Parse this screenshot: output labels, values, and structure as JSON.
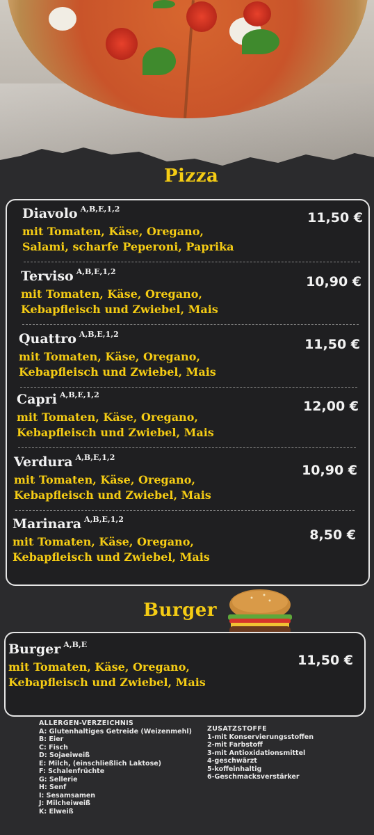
{
  "pizza": {
    "title": "Pizza",
    "items": [
      {
        "name": "Diavolo",
        "allergens": "A,B,E,1,2",
        "desc1": "mit Tomaten, Käse, Oregano,",
        "desc2": "Salami, scharfe Peperoni, Paprika",
        "price": "11,50 €"
      },
      {
        "name": "Terviso",
        "allergens": "A,B,E,1,2",
        "desc1": "mit Tomaten, Käse, Oregano,",
        "desc2": "Kebapfleisch und Zwiebel, Mais",
        "price": "10,90 €"
      },
      {
        "name": "Quattro",
        "allergens": "A,B,E,1,2",
        "desc1": "mit Tomaten, Käse, Oregano,",
        "desc2": "Kebapfleisch und Zwiebel, Mais",
        "price": "11,50 €"
      },
      {
        "name": "Capri",
        "allergens": "A,B,E,1,2",
        "desc1": "mit Tomaten, Käse, Oregano,",
        "desc2": "Kebapfleisch und Zwiebel, Mais",
        "price": "12,00 €"
      },
      {
        "name": "Verdura",
        "allergens": "A,B,E,1,2",
        "desc1": "mit Tomaten, Käse, Oregano,",
        "desc2": "Kebapfleisch und Zwiebel, Mais",
        "price": "10,90 €"
      },
      {
        "name": "Marinara",
        "allergens": "A,B,E,1,2",
        "desc1": "mit Tomaten, Käse, Oregano,",
        "desc2": "Kebapfleisch und Zwiebel, Mais",
        "price": "8,50 €"
      }
    ]
  },
  "burger": {
    "title": "Burger",
    "items": [
      {
        "name": "Burger",
        "allergens": "A,B,E",
        "desc1": "mit Tomaten, Käse, Oregano,",
        "desc2": "Kebapfleisch und Zwiebel, Mais",
        "price": "11,50 €"
      }
    ]
  },
  "allergen_list": {
    "heading": "ALLERGEN-VERZEICHNIS",
    "lines": [
      "A:  Glutenhaltiges Getreide (Weizenmehl)",
      "B:  Eier",
      "C:  Fisch",
      "D:  Sojaeiweiß",
      "E:  Milch,  (einschließlich Laktose)",
      "F:  Schalenfrüchte",
      "G:  Sellerie",
      "H:  Senf",
      "I:   Sesamsamen",
      "J:  Milcheiweiß",
      "K:  Elweiß"
    ]
  },
  "additives": {
    "heading": "ZUSATZSTOFFE",
    "lines": [
      "1-mit Konservierungsstoffen",
      "2-mit Farbstoff",
      "3-mit Antioxidationsmittel",
      "4-geschwärzt",
      "5-koffeinhaltig",
      "6-Geschmacksverstärker"
    ]
  },
  "colors": {
    "accent": "#f5cc14",
    "board": "#2b2b2d",
    "text": "#f2f2f2"
  }
}
